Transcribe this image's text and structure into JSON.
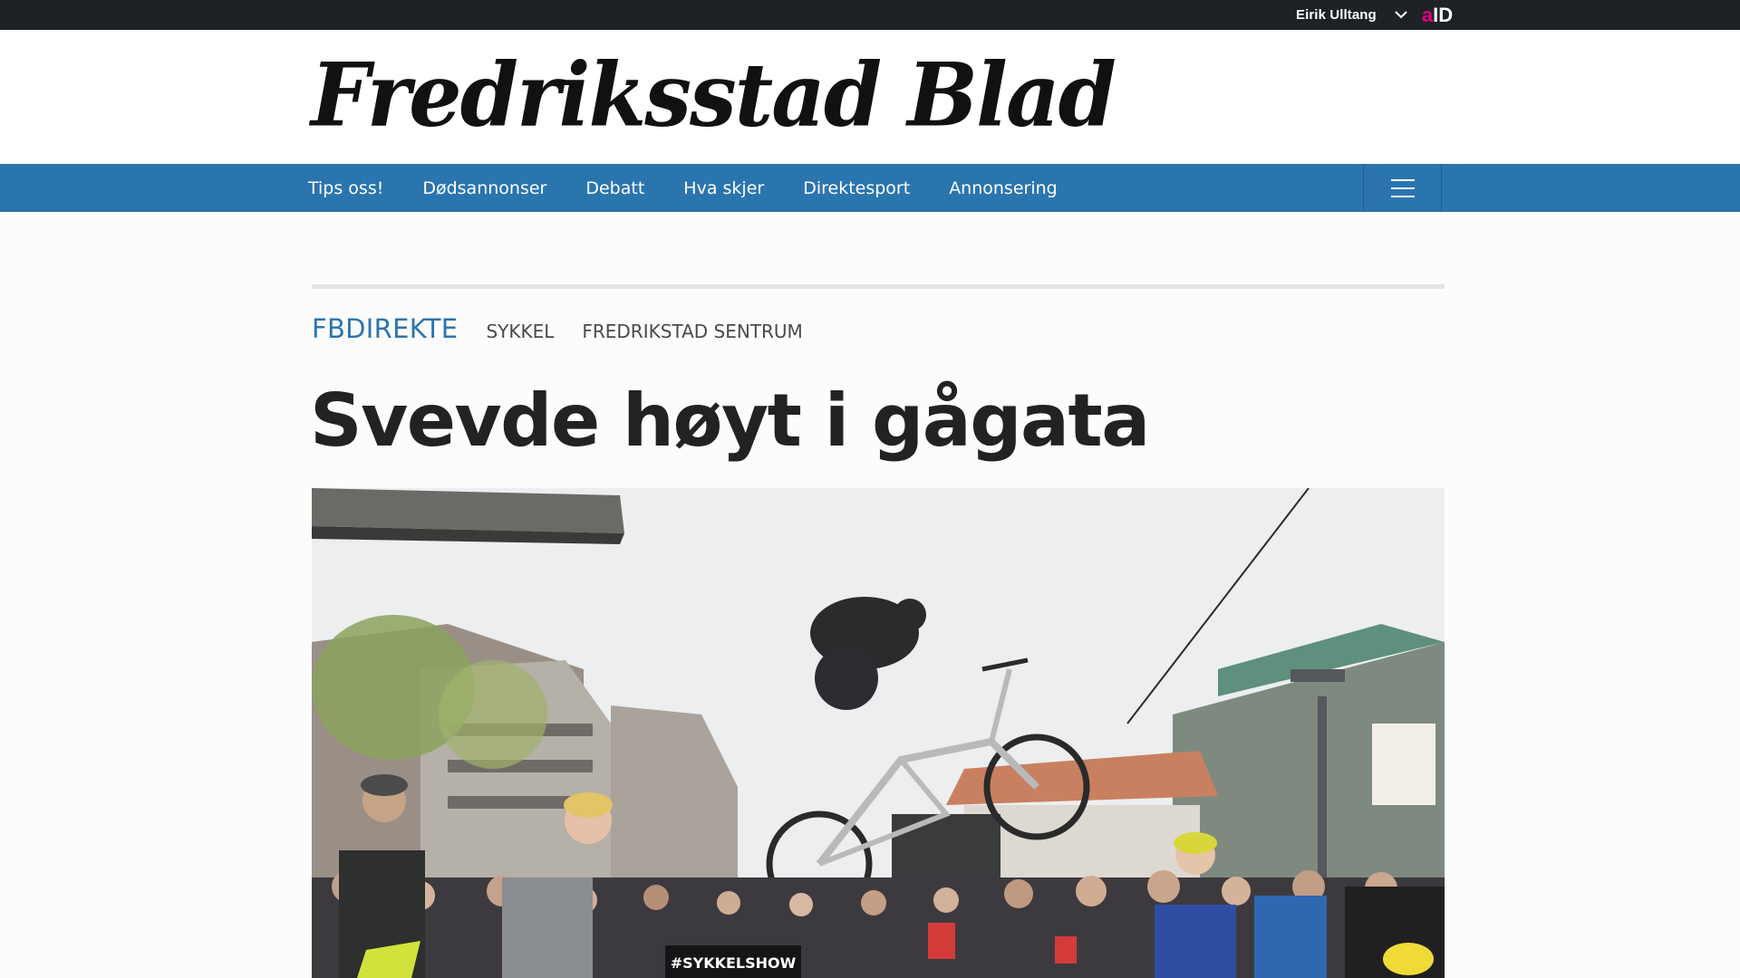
{
  "account": {
    "user_name": "Eirik Ulltang",
    "chevron_icon": "chevron-down-icon",
    "aid_logo_a": "a",
    "aid_logo_id": "ID"
  },
  "masthead": {
    "logo_text": "Fredriksstad Blad"
  },
  "nav": {
    "items": [
      "Tips oss!",
      "Dødsannonser",
      "Debatt",
      "Hva skjer",
      "Direktesport",
      "Annonsering"
    ],
    "menu_icon": "hamburger-menu-icon"
  },
  "article": {
    "tags": [
      "FBDIREKTE",
      "SYKKEL",
      "FREDRIKSTAD SENTRUM"
    ],
    "headline": "Svevde høyt i gågata",
    "image_sign_text": "#SYKKELSHOW"
  },
  "colors": {
    "topbar": "#1e2227",
    "nav": "#2b75ae",
    "tag_primary": "#2b75ae",
    "aid_accent": "#e2007a"
  }
}
